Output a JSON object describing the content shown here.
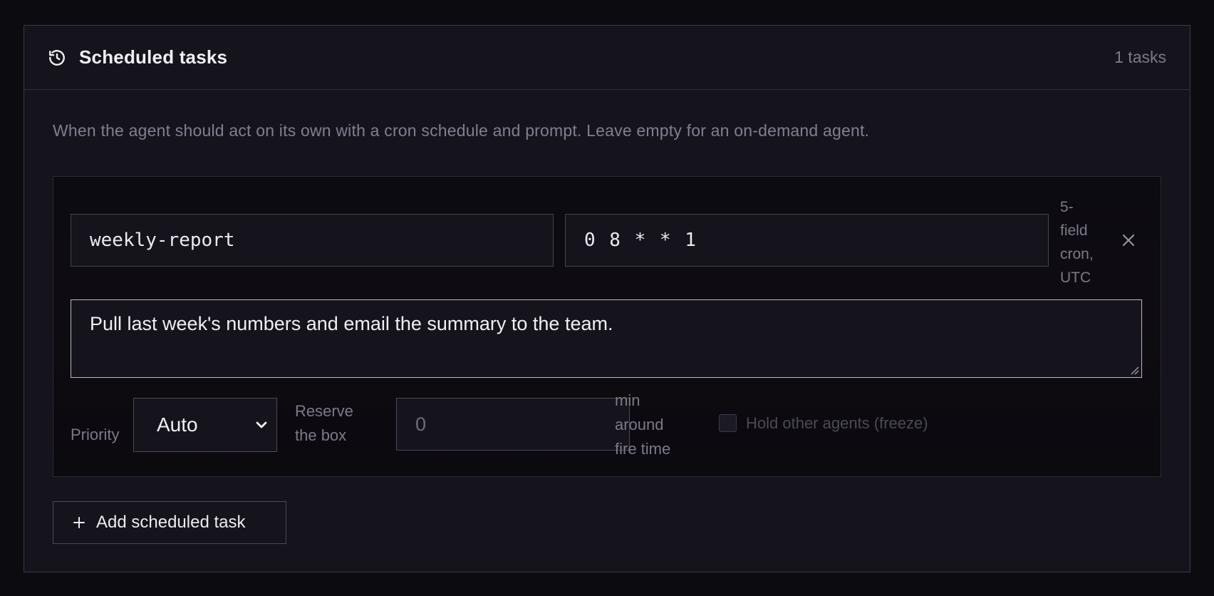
{
  "header": {
    "title": "Scheduled tasks",
    "count": "1 tasks",
    "icon": "history-icon"
  },
  "description": "When the agent should act on its own with a cron schedule and prompt. Leave empty for an on-demand agent.",
  "task": {
    "name": "weekly-report",
    "cron": "0 8 * * 1",
    "cron_hint_lines": [
      "5-",
      "field",
      "cron,",
      "UTC"
    ],
    "prompt": "Pull last week's numbers and email the summary to the team.",
    "priority_label": "Priority",
    "priority_value": "Auto",
    "reserve_label": "Reserve the box",
    "reserve_value": "0",
    "reserve_unit_lines": [
      "min",
      "around",
      "fire time"
    ],
    "freeze_label": "Hold other agents (freeze)",
    "freeze_checked": false
  },
  "add_button_label": "Add scheduled task",
  "colors": {
    "background": "#0b0b10",
    "panel": "#15141d",
    "border": "#3a3948",
    "muted_text": "#7c7a89"
  }
}
